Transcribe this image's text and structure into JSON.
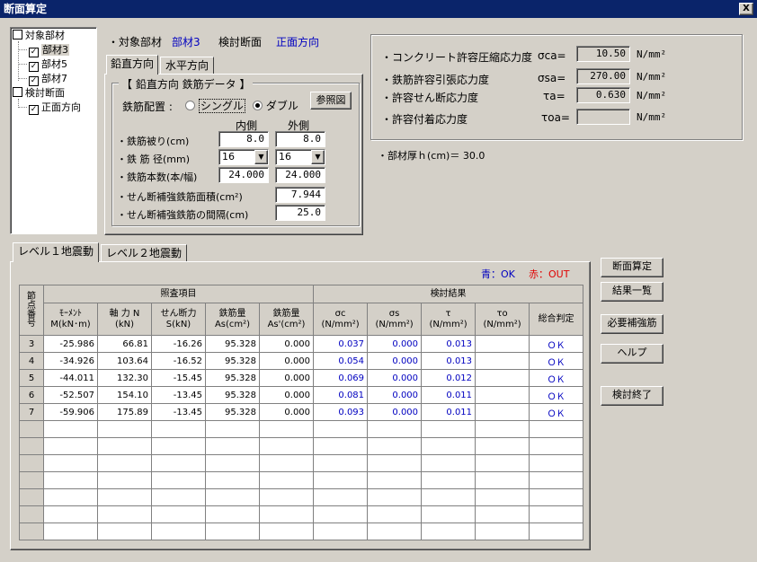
{
  "window": {
    "title": "断面算定",
    "close": "X"
  },
  "tree": [
    {
      "label": "対象部材",
      "checked": false
    },
    {
      "label": "部材3",
      "checked": true,
      "selected": true
    },
    {
      "label": "部材5",
      "checked": true
    },
    {
      "label": "部材7",
      "checked": true
    },
    {
      "label": "検討断面",
      "checked": false
    },
    {
      "label": "正面方向",
      "checked": true
    }
  ],
  "header": {
    "target_member_label": "・対象部材",
    "target_member_value": "部材3",
    "section_label": "検討断面",
    "section_value": "正面方向"
  },
  "tabs_dir": [
    {
      "label": "鉛直方向",
      "active": true
    },
    {
      "label": "水平方向",
      "active": false
    }
  ],
  "rebar": {
    "group_title": "【 鉛直方向 鉄筋データ 】",
    "layout_label": "鉄筋配置 :",
    "single": "シングル",
    "double": "ダブル",
    "selected": "double",
    "ref_button": "参照図",
    "col_inner": "内側",
    "col_outer": "外側",
    "cover_label": "・鉄筋被り(cm)",
    "cover_inner": "8.0",
    "cover_outer": "8.0",
    "dia_label": "・鉄 筋 径(mm)",
    "dia_inner": "16",
    "dia_outer": "16",
    "count_label": "・鉄筋本数(本/幅)",
    "count_inner": "24.000",
    "count_outer": "24.000",
    "shear_area_label": "・せん断補強鉄筋面積(cm²)",
    "shear_area": "7.944",
    "shear_spacing_label": "・せん断補強鉄筋の間隔(cm)",
    "shear_spacing": "25.0"
  },
  "allow": {
    "rows": [
      {
        "label": "・コンクリート許容圧縮応力度",
        "sym": "σca=",
        "value": "10.50",
        "unit": "N/mm²"
      },
      {
        "label": "・鉄筋許容引張応力度",
        "sym": "σsa=",
        "value": "270.00",
        "unit": "N/mm²"
      },
      {
        "label": "・許容せん断応力度",
        "sym": "τa=",
        "value": "0.630",
        "unit": "N/mm²"
      },
      {
        "label": "・許容付着応力度",
        "sym": "τoa=",
        "value": "",
        "unit": "N/mm²"
      }
    ],
    "thickness": "・部材厚ｈ(cm)＝ 30.0"
  },
  "tabs_level": [
    {
      "label": "レベル１地震動",
      "active": true
    },
    {
      "label": "レベル２地震動",
      "active": false
    }
  ],
  "legend": {
    "ok": "青：OK",
    "out": "赤：OUT"
  },
  "table": {
    "h_node": "節点番号",
    "h_check": "照査項目",
    "h_result": "検討結果",
    "cols": [
      "ﾓｰﾒﾝﾄ\nM(kN･m)",
      "軸 力 N\n(kN)",
      "せん断力\nS(kN)",
      "鉄筋量\nAs(cm²)",
      "鉄筋量\nAs'(cm²)",
      "σc\n(N/mm²)",
      "σs\n(N/mm²)",
      "τ\n(N/mm²)",
      "τo\n(N/mm²)",
      "総合判定"
    ],
    "rows": [
      [
        "3",
        "-25.986",
        "66.81",
        "-16.26",
        "95.328",
        "0.000",
        "0.037",
        "0.000",
        "0.013",
        "",
        "ＯＫ"
      ],
      [
        "4",
        "-34.926",
        "103.64",
        "-16.52",
        "95.328",
        "0.000",
        "0.054",
        "0.000",
        "0.013",
        "",
        "ＯＫ"
      ],
      [
        "5",
        "-44.011",
        "132.30",
        "-15.45",
        "95.328",
        "0.000",
        "0.069",
        "0.000",
        "0.012",
        "",
        "ＯＫ"
      ],
      [
        "6",
        "-52.507",
        "154.10",
        "-13.45",
        "95.328",
        "0.000",
        "0.081",
        "0.000",
        "0.011",
        "",
        "ＯＫ"
      ],
      [
        "7",
        "-59.906",
        "175.89",
        "-13.45",
        "95.328",
        "0.000",
        "0.093",
        "0.000",
        "0.011",
        "",
        "ＯＫ"
      ]
    ],
    "empty_rows": 7
  },
  "buttons": {
    "calc": "断面算定",
    "list": "結果一覧",
    "need": "必要補強筋",
    "help": "ヘルプ",
    "end": "検討終了"
  },
  "colors": {
    "ok": "#0000c0",
    "out": "#e00000",
    "title": "#0a246a"
  }
}
